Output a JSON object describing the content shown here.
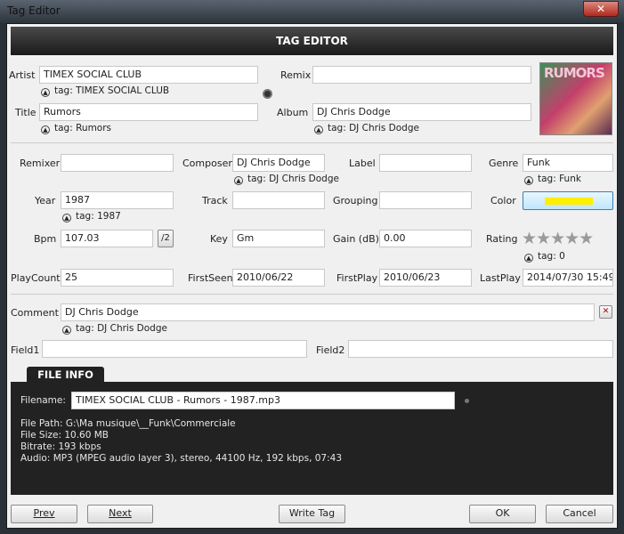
{
  "window": {
    "title": "Tag Editor",
    "close": "✕"
  },
  "header": "TAG EDITOR",
  "artist": {
    "label": "Artist",
    "value": "TIMEX SOCIAL CLUB",
    "tag": "tag: TIMEX SOCIAL CLUB"
  },
  "remix": {
    "label": "Remix",
    "value": ""
  },
  "title": {
    "label": "Title",
    "value": "Rumors",
    "tag": "tag: Rumors"
  },
  "album": {
    "label": "Album",
    "value": "DJ Chris Dodge",
    "tag": "tag: DJ Chris Dodge"
  },
  "cover": {
    "text": "RUMORS"
  },
  "remixer": {
    "label": "Remixer",
    "value": ""
  },
  "composer": {
    "label": "Composer",
    "value": "DJ Chris Dodge",
    "tag": "tag: DJ Chris Dodge"
  },
  "labelf": {
    "label": "Label",
    "value": ""
  },
  "genre": {
    "label": "Genre",
    "value": "Funk",
    "tag": "tag: Funk"
  },
  "year": {
    "label": "Year",
    "value": "1987",
    "tag": "tag: 1987"
  },
  "track": {
    "label": "Track",
    "value": ""
  },
  "grouping": {
    "label": "Grouping",
    "value": ""
  },
  "color": {
    "label": "Color",
    "swatch": "#ffee00"
  },
  "bpm": {
    "label": "Bpm",
    "value": "107.03",
    "half": "/2"
  },
  "key": {
    "label": "Key",
    "value": "Gm"
  },
  "gain": {
    "label": "Gain (dB)",
    "value": "0.00"
  },
  "rating": {
    "label": "Rating",
    "value": 0,
    "max": 5,
    "stars": "★★★★★",
    "tag": "tag: 0"
  },
  "playcount": {
    "label": "PlayCount",
    "value": "25"
  },
  "firstseen": {
    "label": "FirstSeen",
    "value": "2010/06/22"
  },
  "firstplay": {
    "label": "FirstPlay",
    "value": "2010/06/23"
  },
  "lastplay": {
    "label": "LastPlay",
    "value": "2014/07/30 15:49"
  },
  "comment": {
    "label": "Comment",
    "value": "DJ Chris Dodge",
    "tag": "tag: DJ Chris Dodge",
    "clear": "✕"
  },
  "field1": {
    "label": "Field1",
    "value": ""
  },
  "field2": {
    "label": "Field2",
    "value": ""
  },
  "fileinfo": {
    "tab": "FILE INFO",
    "filename_label": "Filename:",
    "filename": "TIMEX SOCIAL CLUB  -  Rumors  -  1987.mp3",
    "path": "File Path: G:\\Ma musique\\__Funk\\Commerciale",
    "size": "File Size: 10.60 MB",
    "bitrate": "Bitrate: 193 kbps",
    "audio": "Audio: MP3 (MPEG audio layer 3), stereo, 44100 Hz, 192 kbps, 07:43"
  },
  "buttons": {
    "prev": "Prev",
    "next": "Next",
    "write": "Write Tag",
    "ok": "OK",
    "cancel": "Cancel"
  }
}
